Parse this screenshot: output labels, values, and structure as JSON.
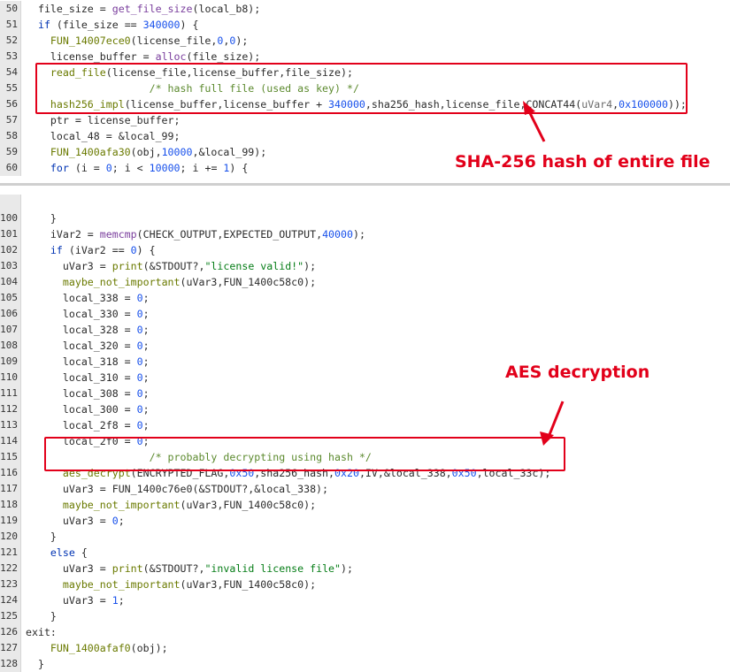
{
  "top_lines": [
    {
      "num": "50",
      "segs": [
        [
          "  file_size = ",
          ""
        ],
        [
          "get_file_size",
          "f"
        ],
        [
          "(local_b8);",
          ""
        ]
      ]
    },
    {
      "num": "51",
      "segs": [
        [
          "  ",
          ""
        ],
        [
          "if",
          "k"
        ],
        [
          " (file_size == ",
          ""
        ],
        [
          "340000",
          "n"
        ],
        [
          ") {",
          ""
        ]
      ]
    },
    {
      "num": "52",
      "segs": [
        [
          "    ",
          ""
        ],
        [
          "FUN_14007ece0",
          "t"
        ],
        [
          "(license_file,",
          ""
        ],
        [
          "0",
          "n"
        ],
        [
          ",",
          ""
        ],
        [
          "0",
          "n"
        ],
        [
          ");",
          ""
        ]
      ]
    },
    {
      "num": "53",
      "segs": [
        [
          "    license_buffer = ",
          ""
        ],
        [
          "alloc",
          "f"
        ],
        [
          "(file_size);",
          ""
        ]
      ]
    },
    {
      "num": "54",
      "segs": [
        [
          "    ",
          ""
        ],
        [
          "read_file",
          "t"
        ],
        [
          "(license_file,license_buffer,file_size);",
          ""
        ]
      ]
    },
    {
      "num": "55",
      "segs": [
        [
          "                    ",
          ""
        ],
        [
          "/* hash full file (used as key) */",
          "c"
        ]
      ]
    },
    {
      "num": "56",
      "segs": [
        [
          "    ",
          ""
        ],
        [
          "hash256_impl",
          "t"
        ],
        [
          "(license_buffer,license_buffer + ",
          ""
        ],
        [
          "340000",
          "n"
        ],
        [
          ",sha256_hash,license_file,CONCAT44(",
          ""
        ],
        [
          "uVar4",
          "v"
        ],
        [
          ",",
          ""
        ],
        [
          "0x100000",
          "n"
        ],
        [
          "));",
          ""
        ]
      ]
    },
    {
      "num": "57",
      "segs": [
        [
          "    ptr = license_buffer;",
          ""
        ]
      ]
    },
    {
      "num": "58",
      "segs": [
        [
          "    local_48 = &local_99;",
          ""
        ]
      ]
    },
    {
      "num": "59",
      "segs": [
        [
          "    ",
          ""
        ],
        [
          "FUN_1400afa30",
          "t"
        ],
        [
          "(obj,",
          ""
        ],
        [
          "10000",
          "n"
        ],
        [
          ",&local_99);",
          ""
        ]
      ]
    },
    {
      "num": "60",
      "segs": [
        [
          "    ",
          ""
        ],
        [
          "for",
          "k"
        ],
        [
          " (i = ",
          ""
        ],
        [
          "0",
          "n"
        ],
        [
          "; i < ",
          ""
        ],
        [
          "10000",
          "n"
        ],
        [
          "; i += ",
          ""
        ],
        [
          "1",
          "n"
        ],
        [
          ") {",
          ""
        ]
      ]
    }
  ],
  "bottom_lines": [
    {
      "num": "",
      "segs": [
        [
          "",
          ""
        ]
      ]
    },
    {
      "num": "100",
      "segs": [
        [
          "    }",
          ""
        ]
      ]
    },
    {
      "num": "101",
      "segs": [
        [
          "    iVar2 = ",
          ""
        ],
        [
          "memcmp",
          "f"
        ],
        [
          "(CHECK_OUTPUT,EXPECTED_OUTPUT,",
          ""
        ],
        [
          "40000",
          "n"
        ],
        [
          ");",
          ""
        ]
      ]
    },
    {
      "num": "102",
      "segs": [
        [
          "    ",
          ""
        ],
        [
          "if",
          "k"
        ],
        [
          " (iVar2 == ",
          ""
        ],
        [
          "0",
          "n"
        ],
        [
          ") {",
          ""
        ]
      ]
    },
    {
      "num": "103",
      "segs": [
        [
          "      uVar3 = ",
          ""
        ],
        [
          "print",
          "t"
        ],
        [
          "(&STDOUT?,",
          ""
        ],
        [
          "\"license valid!\"",
          "s"
        ],
        [
          ");",
          ""
        ]
      ]
    },
    {
      "num": "104",
      "segs": [
        [
          "      ",
          ""
        ],
        [
          "maybe_not_important",
          "t"
        ],
        [
          "(uVar3,FUN_1400c58c0);",
          ""
        ]
      ]
    },
    {
      "num": "105",
      "segs": [
        [
          "      local_338 = ",
          ""
        ],
        [
          "0",
          "n"
        ],
        [
          ";",
          ""
        ]
      ]
    },
    {
      "num": "106",
      "segs": [
        [
          "      local_330 = ",
          ""
        ],
        [
          "0",
          "n"
        ],
        [
          ";",
          ""
        ]
      ]
    },
    {
      "num": "107",
      "segs": [
        [
          "      local_328 = ",
          ""
        ],
        [
          "0",
          "n"
        ],
        [
          ";",
          ""
        ]
      ]
    },
    {
      "num": "108",
      "segs": [
        [
          "      local_320 = ",
          ""
        ],
        [
          "0",
          "n"
        ],
        [
          ";",
          ""
        ]
      ]
    },
    {
      "num": "109",
      "segs": [
        [
          "      local_318 = ",
          ""
        ],
        [
          "0",
          "n"
        ],
        [
          ";",
          ""
        ]
      ]
    },
    {
      "num": "110",
      "segs": [
        [
          "      local_310 = ",
          ""
        ],
        [
          "0",
          "n"
        ],
        [
          ";",
          ""
        ]
      ]
    },
    {
      "num": "111",
      "segs": [
        [
          "      local_308 = ",
          ""
        ],
        [
          "0",
          "n"
        ],
        [
          ";",
          ""
        ]
      ]
    },
    {
      "num": "112",
      "segs": [
        [
          "      local_300 = ",
          ""
        ],
        [
          "0",
          "n"
        ],
        [
          ";",
          ""
        ]
      ]
    },
    {
      "num": "113",
      "segs": [
        [
          "      local_2f8 = ",
          ""
        ],
        [
          "0",
          "n"
        ],
        [
          ";",
          ""
        ]
      ]
    },
    {
      "num": "114",
      "segs": [
        [
          "      local_2f0 = ",
          ""
        ],
        [
          "0",
          "n"
        ],
        [
          ";",
          ""
        ]
      ]
    },
    {
      "num": "115",
      "segs": [
        [
          "                    ",
          ""
        ],
        [
          "/* probably decrypting using hash */",
          "c"
        ]
      ]
    },
    {
      "num": "116",
      "segs": [
        [
          "      ",
          ""
        ],
        [
          "aes_decrypt",
          "t"
        ],
        [
          "(ENCRYPTED_FLAG,",
          ""
        ],
        [
          "0x50",
          "n"
        ],
        [
          ",sha256_hash,",
          ""
        ],
        [
          "0x20",
          "n"
        ],
        [
          ",IV,&local_338,",
          ""
        ],
        [
          "0x50",
          "n"
        ],
        [
          ",local_33c);",
          ""
        ]
      ]
    },
    {
      "num": "117",
      "segs": [
        [
          "      uVar3 = FUN_1400c76e0(&STDOUT?,&local_338);",
          ""
        ]
      ]
    },
    {
      "num": "118",
      "segs": [
        [
          "      ",
          ""
        ],
        [
          "maybe_not_important",
          "t"
        ],
        [
          "(uVar3,FUN_1400c58c0);",
          ""
        ]
      ]
    },
    {
      "num": "119",
      "segs": [
        [
          "      uVar3 = ",
          ""
        ],
        [
          "0",
          "n"
        ],
        [
          ";",
          ""
        ]
      ]
    },
    {
      "num": "120",
      "segs": [
        [
          "    }",
          ""
        ]
      ]
    },
    {
      "num": "121",
      "segs": [
        [
          "    ",
          ""
        ],
        [
          "else",
          "k"
        ],
        [
          " {",
          ""
        ]
      ]
    },
    {
      "num": "122",
      "segs": [
        [
          "      uVar3 = ",
          ""
        ],
        [
          "print",
          "t"
        ],
        [
          "(&STDOUT?,",
          ""
        ],
        [
          "\"invalid license file\"",
          "s"
        ],
        [
          ");",
          ""
        ]
      ]
    },
    {
      "num": "123",
      "segs": [
        [
          "      ",
          ""
        ],
        [
          "maybe_not_important",
          "t"
        ],
        [
          "(uVar3,FUN_1400c58c0);",
          ""
        ]
      ]
    },
    {
      "num": "124",
      "segs": [
        [
          "      uVar3 = ",
          ""
        ],
        [
          "1",
          "n"
        ],
        [
          ";",
          ""
        ]
      ]
    },
    {
      "num": "125",
      "segs": [
        [
          "    }",
          ""
        ]
      ]
    },
    {
      "num": "126",
      "segs": [
        [
          "exit:",
          ""
        ]
      ]
    },
    {
      "num": "127",
      "segs": [
        [
          "    ",
          ""
        ],
        [
          "FUN_1400afaf0",
          "t"
        ],
        [
          "(obj);",
          ""
        ]
      ]
    },
    {
      "num": "128",
      "segs": [
        [
          "  }",
          ""
        ]
      ]
    }
  ],
  "annotations": {
    "sha_label": "SHA-256 hash of entire file",
    "aes_label": "AES decryption"
  },
  "colors": {
    "annotation": "#e2001a",
    "keyword": "#0033b3",
    "function": "#7a3e9d",
    "number": "#1750eb",
    "string": "#067d17",
    "comment": "#5c8a2e"
  }
}
